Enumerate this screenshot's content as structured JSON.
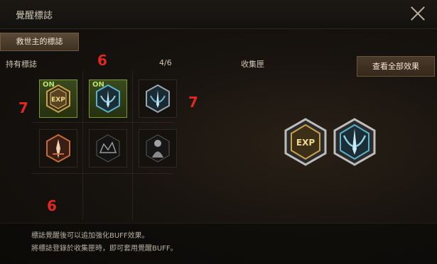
{
  "window": {
    "title": "覺醒標誌"
  },
  "tab": {
    "label": "救世主的標誌"
  },
  "header": {
    "owned_label": "持有標誌",
    "count": "4/6",
    "collection_label": "收集匣",
    "view_all_button": "查看全部效果"
  },
  "badges": [
    {
      "name": "exp-badge",
      "on": true,
      "on_label": "ON",
      "text": "EXP",
      "tint": "#c9a24a"
    },
    {
      "name": "wing-sword-badge",
      "on": true,
      "on_label": "ON",
      "text": "",
      "tint": "#58b2c8"
    },
    {
      "name": "wing-sword-badge-2",
      "on": false,
      "on_label": "",
      "text": "",
      "tint": "#6ab4d0"
    },
    {
      "name": "torch-badge",
      "on": false,
      "on_label": "",
      "text": "",
      "tint": "#c46a3c"
    },
    {
      "name": "crystal-badge",
      "on": false,
      "on_label": "",
      "text": "",
      "tint": "#9a9a9a"
    },
    {
      "name": "statue-badge",
      "on": false,
      "on_label": "",
      "text": "",
      "tint": "#a0a0a0"
    }
  ],
  "collection": [
    {
      "name": "collected-exp-badge",
      "text": "EXP",
      "tint": "#c9a24a"
    },
    {
      "name": "collected-wing-sword-badge",
      "text": "",
      "tint": "#58b2c8"
    }
  ],
  "annotations": {
    "mark_top": "6",
    "mark_left": "7",
    "mark_right": "7",
    "mark_bottom": "6"
  },
  "footer": {
    "line1": "標誌覺醒後可以追加強化BUFF效果。",
    "line2": "將標誌登錄於收集匣時，即可套用覺醒BUFF。"
  },
  "colors": {
    "accent_green": "#b8e06a",
    "annotation_red": "#e0281e",
    "brown_button": "#4a3a28"
  }
}
